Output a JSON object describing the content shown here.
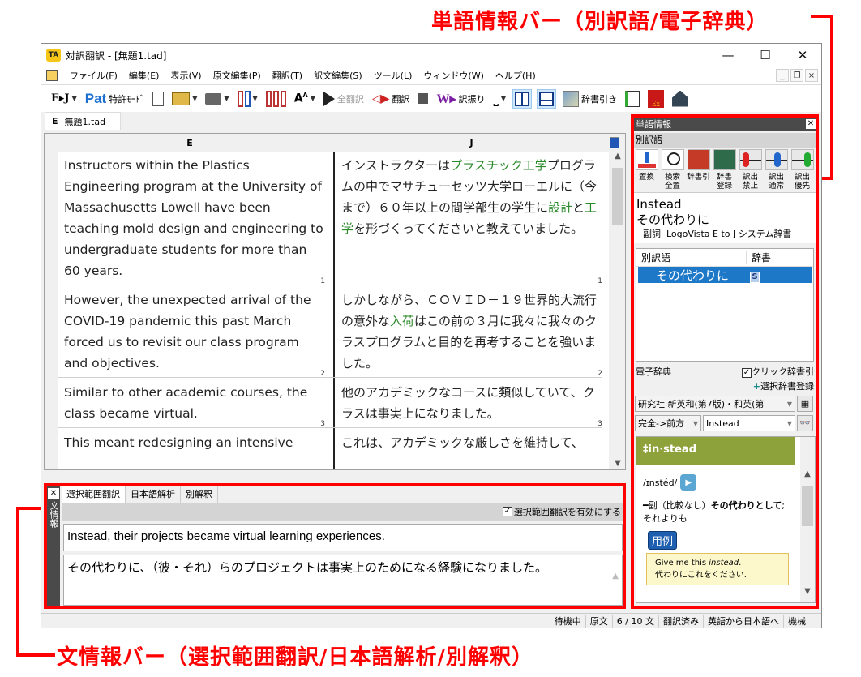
{
  "annotations": {
    "top": "単語情報バー（別訳語/電子辞典）",
    "bottom": "文情報バー（選択範囲翻訳/日本語解析/別解釈）",
    "color": "#ff0000"
  },
  "window": {
    "app_icon": "TA",
    "title": "対訳翻訳 - [無題1.tad]",
    "controls": {
      "minimize": "—",
      "maximize": "☐",
      "close": "✕"
    }
  },
  "menu": {
    "items": [
      "ファイル(F)",
      "編集(E)",
      "表示(V)",
      "原文編集(P)",
      "翻訳(T)",
      "訳文編集(S)",
      "ツール(L)",
      "ウィンドウ(W)",
      "ヘルプ(H)"
    ],
    "mdi": {
      "minimize": "_",
      "restore": "❐",
      "close": "×"
    }
  },
  "toolbar": {
    "direction": "E▸J",
    "patent_logo": "Pat",
    "patent_mode": "特許ﾓｰﾄﾞ",
    "translate_all": "全翻訳",
    "translate": "翻訳",
    "assign": "訳振り",
    "space": "⎵",
    "dictionary_lookup": "辞書引き",
    "ex_label": "Ex"
  },
  "document": {
    "tab_lang": "E",
    "tab_name": "無題1.tad",
    "col_e": "E",
    "col_j": "J",
    "segments": [
      {
        "en": "Instructors within the Plastics Engineering program at the University of Massachusetts Lowell have been teaching mold design and engineering to undergraduate students for more than 60 years.",
        "ja_parts": [
          {
            "t": "インストラクターは"
          },
          {
            "t": "プラスチック工学",
            "g": true
          },
          {
            "t": "プログラムの中でマサチューセッツ大学ローエルに（今まで）６０年以上の間学部生の学生に"
          },
          {
            "t": "設計",
            "g": true
          },
          {
            "t": "と"
          },
          {
            "t": "工学",
            "g": true
          },
          {
            "t": "を形づくってくださいと教えていました。"
          }
        ],
        "num": "1"
      },
      {
        "en": "However, the unexpected arrival of the COVID-19 pandemic this past March forced us to revisit our class program and objectives.",
        "ja_parts": [
          {
            "t": "しかしながら、ＣＯＶＩＤ－１９世界的大流行の意外な"
          },
          {
            "t": "入荷",
            "g": true
          },
          {
            "t": "はこの前の３月に我々に我々のクラスプログラムと目的を再考することを強いました。"
          }
        ],
        "num": "2"
      },
      {
        "en": "Similar to other academic courses, the class became virtual.",
        "ja_parts": [
          {
            "t": "他のアカデミックなコースに類似していて、クラスは事実上になりました。"
          }
        ],
        "num": "3"
      },
      {
        "en": "This meant redesigning an intensive",
        "ja_parts": [
          {
            "t": "これは、アカデミックな厳しさを維持して、"
          }
        ],
        "num": ""
      }
    ]
  },
  "sentence_panel": {
    "close": "✕",
    "label": "文情報",
    "tabs": [
      "選択範囲翻訳",
      "日本語解析",
      "別解釈"
    ],
    "active_tab": 0,
    "enable_checkbox": {
      "checked": true,
      "label": "選択範囲翻訳を有効にする"
    },
    "source": "Instead, their projects became virtual learning experiences.",
    "target": "その代わりに、（彼・それ）らのプロジェクトは事実上のためになる経験になりました。"
  },
  "word_panel": {
    "title": "単語情報",
    "close": "✕",
    "alt_section": "別訳語",
    "icons": [
      {
        "name": "replace",
        "label": "置換"
      },
      {
        "name": "search-replace-all",
        "label": "検索\n全置"
      },
      {
        "name": "dictionary-lookup",
        "label": "辞書引"
      },
      {
        "name": "dictionary-register",
        "label": "辞書\n登録"
      },
      {
        "name": "prohibit",
        "label": "訳出\n禁止"
      },
      {
        "name": "normal",
        "label": "訳出\n通常"
      },
      {
        "name": "priority",
        "label": "訳出\n優先"
      }
    ],
    "entry": {
      "word": "Instead",
      "translation": "その代わりに",
      "pos": "副詞",
      "dictionary": "LogoVista E to J システム辞書"
    },
    "table": {
      "headers": [
        "別訳語",
        "辞書"
      ],
      "rows": [
        {
          "term": "その代わりに",
          "dict": "S"
        }
      ]
    },
    "edict": {
      "title": "電子辞典",
      "click_lookup": {
        "checked": true,
        "label": "クリック辞書引"
      },
      "register_selected": "選択辞書登録",
      "dictionary_select": "研究社 新英和(第7版)・和英(第",
      "match_mode": "完全->前方",
      "query": "Instead",
      "headword": "‡in·stead",
      "pronunciation": "/ɪnstéd/",
      "definition_prefix": "━副（比較なし）",
      "definition_bold": "その代わりとして",
      "definition_suffix": ";それよりも",
      "example_badge": "用例",
      "example_en_before": "Give me this ",
      "example_en_italic": "instead",
      "example_en_after": ".",
      "example_ja": "代わりにこれをください."
    }
  },
  "status": [
    "待機中",
    "原文",
    "6 / 10 文",
    "翻訳済み",
    "英語から日本語へ",
    "機械"
  ]
}
